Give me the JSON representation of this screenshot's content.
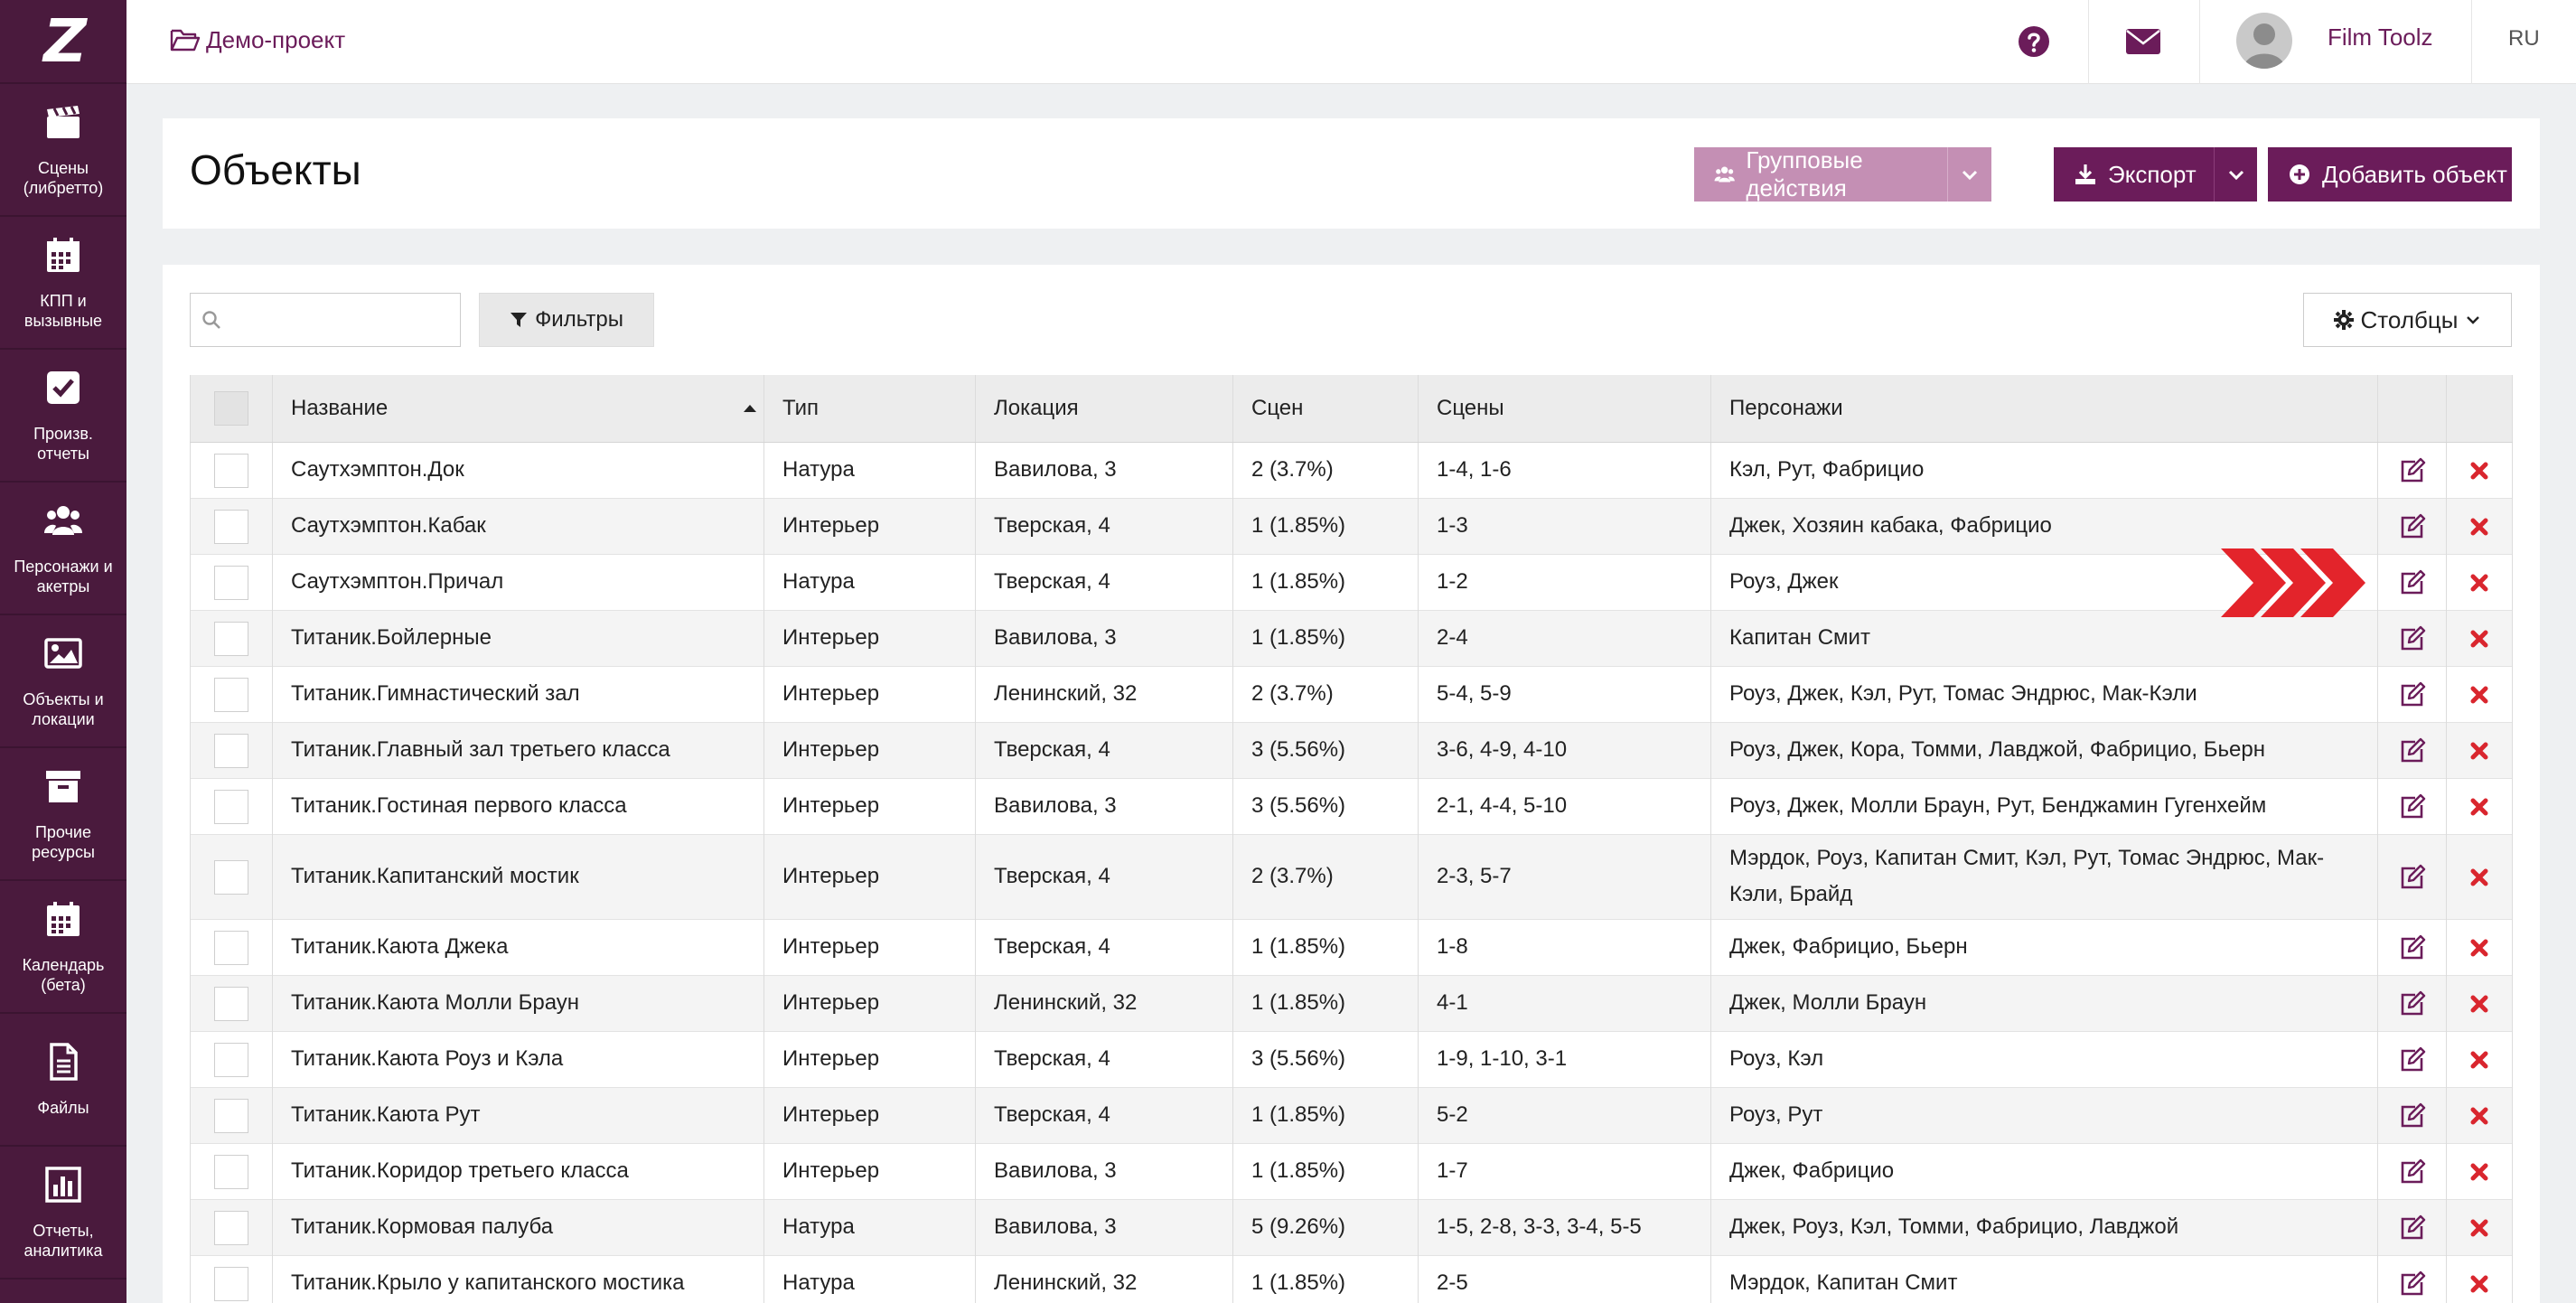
{
  "sidebar": {
    "logo": "Z",
    "items": [
      {
        "label": "Сцены\n(либретто)",
        "icon": "clapperboard-icon"
      },
      {
        "label": "КПП и\nвызывные",
        "icon": "calendar-icon"
      },
      {
        "label": "Произв. отчеты",
        "icon": "checkbox-icon"
      },
      {
        "label": "Персонажи и\nакетры",
        "icon": "users-icon"
      },
      {
        "label": "Объекты и\nлокации",
        "icon": "image-icon"
      },
      {
        "label": "Прочие\nресурсы",
        "icon": "archive-icon"
      },
      {
        "label": "Календарь\n(бета)",
        "icon": "calendar-icon"
      },
      {
        "label": "Файлы",
        "icon": "file-icon"
      },
      {
        "label": "Отчеты,\nаналитика",
        "icon": "bar-chart-icon"
      }
    ]
  },
  "topbar": {
    "project": "Демо-проект",
    "username": "Film Toolz",
    "lang": "RU"
  },
  "header": {
    "title": "Объекты",
    "group_actions": "Групповые действия",
    "export": "Экспорт",
    "add_object": "Добавить объект"
  },
  "toolbar": {
    "search_placeholder": "",
    "filters": "Фильтры",
    "columns": "Столбцы"
  },
  "table": {
    "columns": [
      "Название",
      "Тип",
      "Локация",
      "Сцен",
      "Сцены",
      "Персонажи"
    ],
    "rows": [
      {
        "name": "Саутхэмптон.Док",
        "type": "Натура",
        "location": "Вавилова, 3",
        "count": "2 (3.7%)",
        "scenes": "1-4, 1-6",
        "characters": "Кэл, Рут, Фабрицио"
      },
      {
        "name": "Саутхэмптон.Кабак",
        "type": "Интерьер",
        "location": "Тверская, 4",
        "count": "1 (1.85%)",
        "scenes": "1-3",
        "characters": "Джек, Хозяин кабака, Фабрицио"
      },
      {
        "name": "Саутхэмптон.Причал",
        "type": "Натура",
        "location": "Тверская, 4",
        "count": "1 (1.85%)",
        "scenes": "1-2",
        "characters": "Роуз, Джек"
      },
      {
        "name": "Титаник.Бойлерные",
        "type": "Интерьер",
        "location": "Вавилова, 3",
        "count": "1 (1.85%)",
        "scenes": "2-4",
        "characters": "Капитан Смит"
      },
      {
        "name": "Титаник.Гимнастический зал",
        "type": "Интерьер",
        "location": "Ленинский, 32",
        "count": "2 (3.7%)",
        "scenes": "5-4, 5-9",
        "characters": "Роуз, Джек, Кэл, Рут, Томас Эндрюс, Мак-Кэли"
      },
      {
        "name": "Титаник.Главный зал третьего класса",
        "type": "Интерьер",
        "location": "Тверская, 4",
        "count": "3 (5.56%)",
        "scenes": "3-6, 4-9, 4-10",
        "characters": "Роуз, Джек, Кора, Томми, Лавджой, Фабрицио, Бьерн"
      },
      {
        "name": "Титаник.Гостиная первого класса",
        "type": "Интерьер",
        "location": "Вавилова, 3",
        "count": "3 (5.56%)",
        "scenes": "2-1, 4-4, 5-10",
        "characters": "Роуз, Джек, Молли Браун, Рут, Бенджамин Гугенхейм"
      },
      {
        "name": "Титаник.Капитанский мостик",
        "type": "Интерьер",
        "location": "Тверская, 4",
        "count": "2 (3.7%)",
        "scenes": "2-3, 5-7",
        "characters": "Мэрдок, Роуз, Капитан Смит, Кэл, Рут, Томас Эндрюс, Мак-Кэли, Брайд"
      },
      {
        "name": "Титаник.Каюта Джека",
        "type": "Интерьер",
        "location": "Тверская, 4",
        "count": "1 (1.85%)",
        "scenes": "1-8",
        "characters": "Джек, Фабрицио, Бьерн"
      },
      {
        "name": "Титаник.Каюта Молли Браун",
        "type": "Интерьер",
        "location": "Ленинский, 32",
        "count": "1 (1.85%)",
        "scenes": "4-1",
        "characters": "Джек, Молли Браун"
      },
      {
        "name": "Титаник.Каюта Роуз и Кэла",
        "type": "Интерьер",
        "location": "Тверская, 4",
        "count": "3 (5.56%)",
        "scenes": "1-9, 1-10, 3-1",
        "characters": "Роуз, Кэл"
      },
      {
        "name": "Титаник.Каюта Рут",
        "type": "Интерьер",
        "location": "Тверская, 4",
        "count": "1 (1.85%)",
        "scenes": "5-2",
        "characters": "Роуз, Рут"
      },
      {
        "name": "Титаник.Коридор третьего класса",
        "type": "Интерьер",
        "location": "Вавилова, 3",
        "count": "1 (1.85%)",
        "scenes": "1-7",
        "characters": "Джек, Фабрицио"
      },
      {
        "name": "Титаник.Кормовая палуба",
        "type": "Натура",
        "location": "Вавилова, 3",
        "count": "5 (9.26%)",
        "scenes": "1-5, 2-8, 3-3, 3-4, 5-5",
        "characters": "Джек, Роуз, Кэл, Томми, Фабрицио, Лавджой"
      },
      {
        "name": "Титаник.Крыло у капитанского мостика",
        "type": "Натура",
        "location": "Ленинский, 32",
        "count": "1 (1.85%)",
        "scenes": "2-5",
        "characters": "Мэрдок, Капитан Смит"
      }
    ]
  },
  "colors": {
    "sidebar": "#4a1a3d",
    "primary": "#6b1c5a",
    "primary_light": "#c48fb4",
    "delete": "#d9262e",
    "highlight_arrow": "#e3242b"
  }
}
